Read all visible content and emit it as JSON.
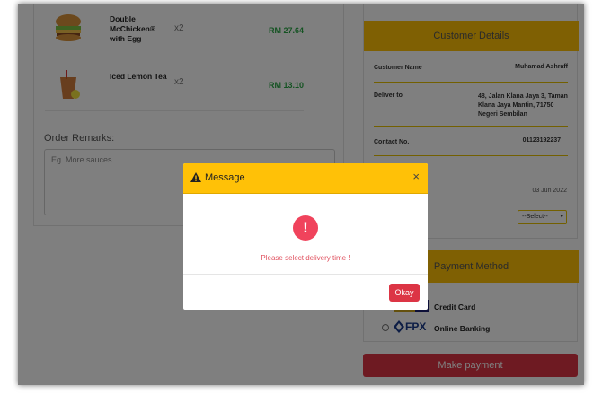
{
  "order": {
    "items": [
      {
        "name": "Double McChicken® with Egg",
        "qty": "x2",
        "price": "RM 27.64",
        "icon": "burger-icon"
      },
      {
        "name": "Iced Lemon Tea",
        "qty": "x2",
        "price": "RM 13.10",
        "icon": "lemon-tea-icon"
      }
    ],
    "remarks_label": "Order Remarks:",
    "remarks_placeholder": "Eg. More sauces"
  },
  "customer": {
    "header": "Customer Details",
    "name_label": "Customer Name",
    "name_value": "Muhamad Ashraff",
    "deliver_label": "Deliver to",
    "deliver_value": "48, Jalan Klana Jaya 3, Taman Klana Jaya Mantin, 71750 Negeri Sembilan",
    "contact_label": "Contact No.",
    "contact_value": "01123192237",
    "date": "03 Jun 2022",
    "delivery_select": "--Select--"
  },
  "payment": {
    "header": "Payment Method",
    "options": [
      {
        "label": "Credit Card",
        "icon": "credit-card-icon"
      },
      {
        "label": "Online Banking",
        "icon": "fpx-logo",
        "logo_text": "FPX"
      }
    ],
    "submit_label": "Make payment"
  },
  "modal": {
    "title": "Message",
    "close": "×",
    "icon": "exclamation-icon",
    "icon_glyph": "!",
    "message": "Please select delivery time !",
    "ok_label": "Okay"
  },
  "colors": {
    "accent": "#ffc107",
    "danger": "#dc3545",
    "price": "#28a745",
    "alert": "#f0435c"
  }
}
